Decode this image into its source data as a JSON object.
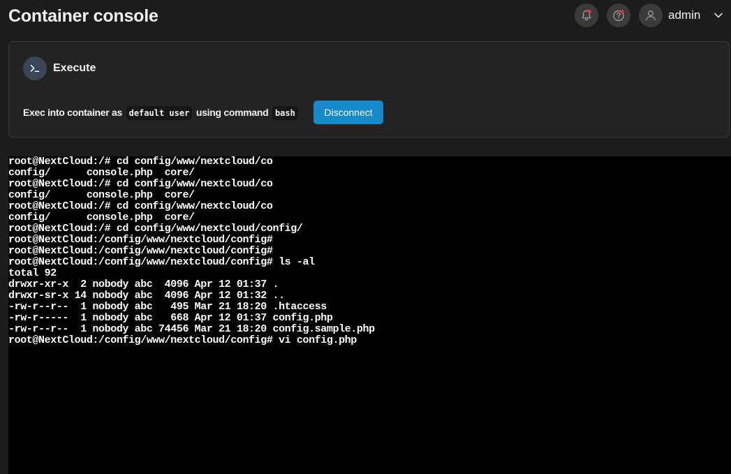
{
  "header": {
    "title": "Container console",
    "username": "admin",
    "icons": {
      "notifications": "bell-icon",
      "help": "help-icon",
      "avatar": "user-icon",
      "menu": "chevron-down-icon"
    }
  },
  "execute": {
    "title": "Execute",
    "icon": "terminal-prompt-icon",
    "text_prefix": "Exec into container as",
    "user": "default user",
    "text_mid": "using command",
    "command": "bash",
    "button_label": "Disconnect"
  },
  "terminal": {
    "lines": [
      "root@NextCloud:/# cd config/www/nextcloud/co",
      "config/      console.php  core/",
      "root@NextCloud:/# cd config/www/nextcloud/co",
      "config/      console.php  core/",
      "root@NextCloud:/# cd config/www/nextcloud/co",
      "config/      console.php  core/",
      "root@NextCloud:/# cd config/www/nextcloud/config/",
      "root@NextCloud:/config/www/nextcloud/config#",
      "root@NextCloud:/config/www/nextcloud/config#",
      "root@NextCloud:/config/www/nextcloud/config# ls -al",
      "total 92",
      "drwxr-xr-x  2 nobody abc  4096 Apr 12 01:37 .",
      "drwxr-sr-x 14 nobody abc  4096 Apr 12 01:32 ..",
      "-rw-r--r--  1 nobody abc   495 Mar 21 18:20 .htaccess",
      "-rw-r-----  1 nobody abc   668 Apr 12 01:37 config.php",
      "-rw-r--r--  1 nobody abc 74456 Mar 21 18:20 config.sample.php",
      "root@NextCloud:/config/www/nextcloud/config# vi config.php"
    ]
  },
  "colors": {
    "background": "#1c1c1c",
    "card": "#232323",
    "accent": "#1689ca",
    "notification_dot": "#e5342c",
    "terminal_bg": "#000000"
  }
}
